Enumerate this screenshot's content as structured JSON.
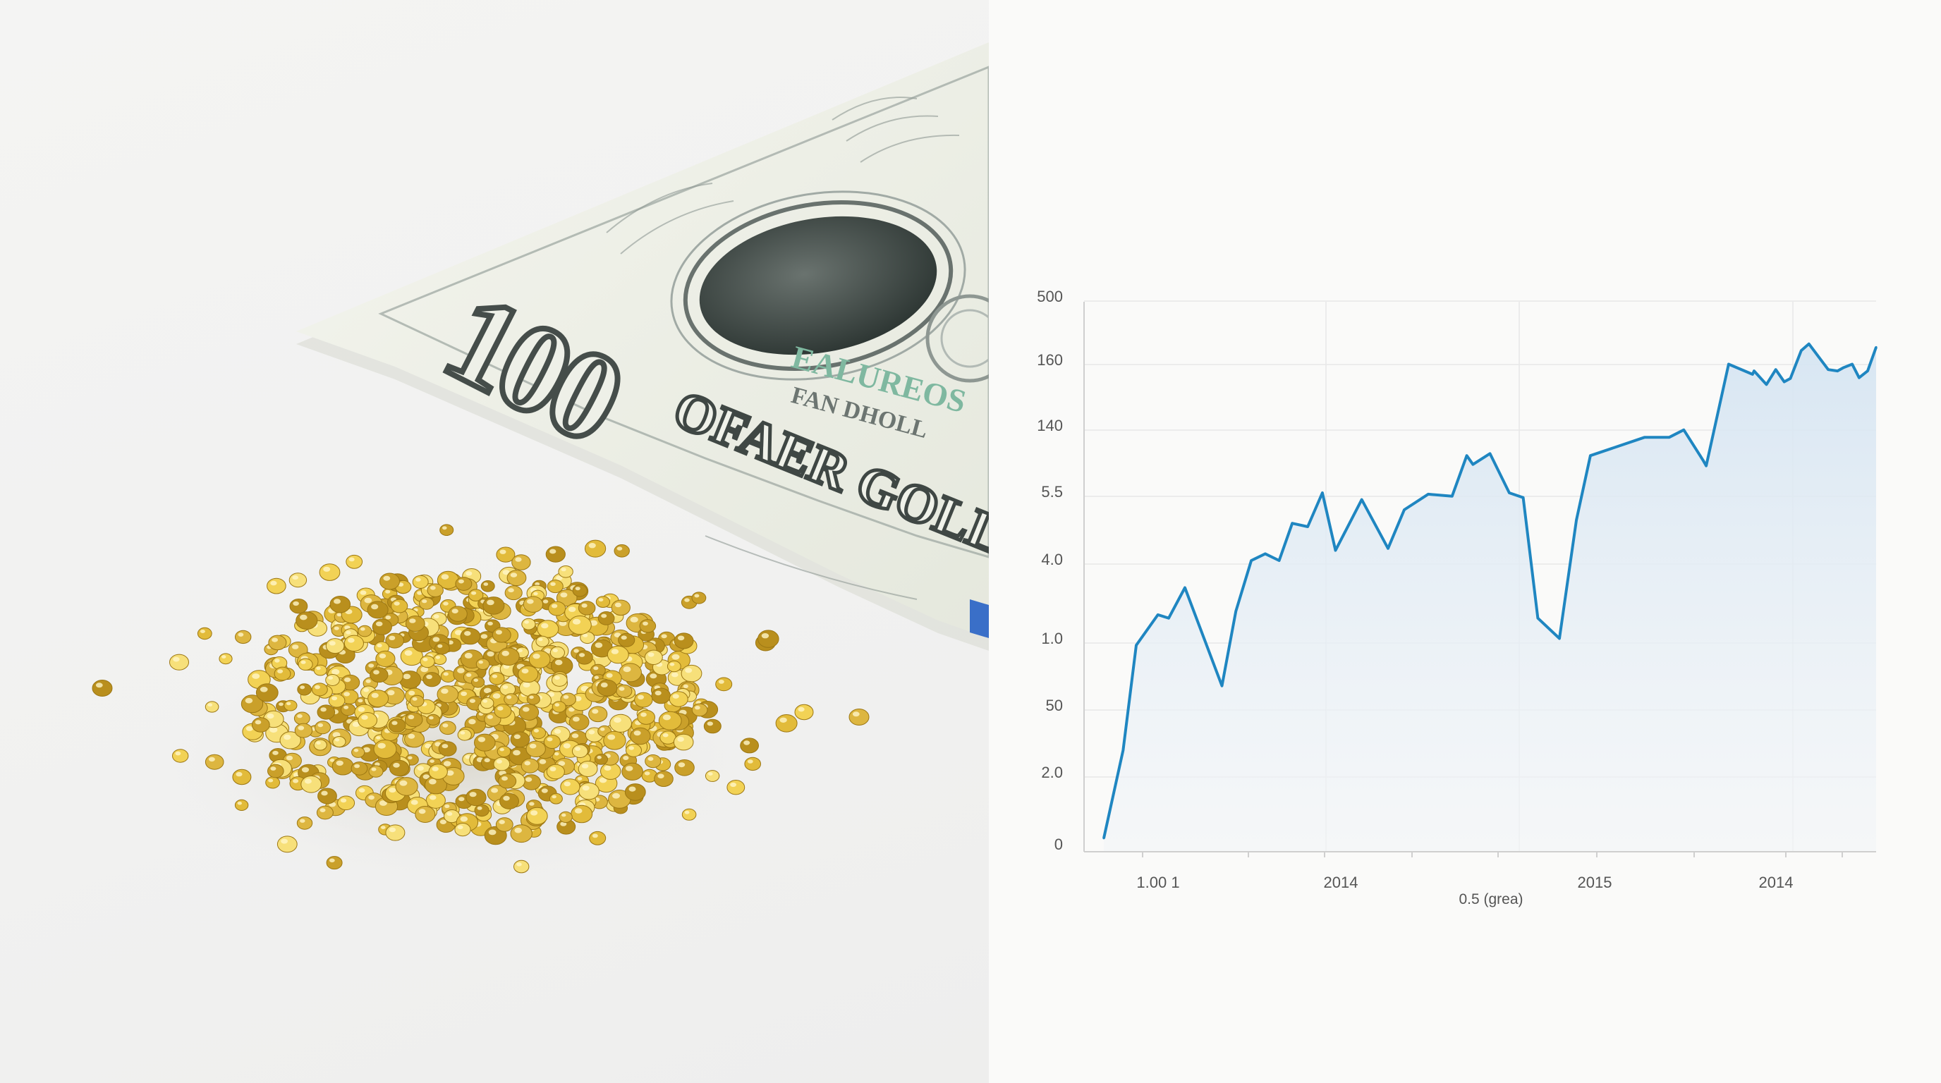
{
  "photo": {
    "banknote": {
      "denomination": "100",
      "lines": [
        "EALUREOS",
        "FAN DHOLL",
        "OFAER GOLL"
      ]
    },
    "colors": {
      "gold": "#e2bb3a",
      "banknote_paper": "#eef0e6",
      "banknote_ink": "#4a5450",
      "banknote_green": "#7fb8a0",
      "blue_strip": "#3a6fc8"
    }
  },
  "chart_data": {
    "type": "area",
    "title": "",
    "xlabel": "",
    "ylabel": "",
    "note": "0.5 (grea)",
    "y_tick_labels": [
      "500",
      "160",
      "140",
      "5.5",
      "4.0",
      "1.0",
      "50",
      "2.0",
      "0"
    ],
    "x_tick_labels": [
      "1.00 1",
      "2014",
      "2015",
      "2014"
    ],
    "ylim": [
      0,
      8
    ],
    "grid": true,
    "legend": "none",
    "colors": {
      "line": "#1f86c1",
      "fill": "#dbe8f3",
      "grid": "#e8e8e8",
      "axis": "#cfcfcf",
      "text": "#555555"
    },
    "series": [
      {
        "x": [
          0.0,
          0.025,
          0.042,
          0.07,
          0.084,
          0.105,
          0.153,
          0.171,
          0.191,
          0.209,
          0.227,
          0.244,
          0.264,
          0.283,
          0.3,
          0.334,
          0.368,
          0.389,
          0.42,
          0.451,
          0.47,
          0.478,
          0.5,
          0.525,
          0.543,
          0.562,
          0.59,
          0.612,
          0.63,
          0.7,
          0.732,
          0.751,
          0.776,
          0.78,
          0.809,
          0.84,
          0.842,
          0.858,
          0.87,
          0.881,
          0.889,
          0.903,
          0.913,
          0.938,
          0.95,
          0.958,
          0.969,
          0.978,
          0.989,
          1.0
        ],
        "y": [
          0.2,
          1.5,
          3.05,
          3.5,
          3.45,
          3.9,
          2.45,
          3.55,
          4.3,
          4.4,
          4.3,
          4.85,
          4.8,
          5.3,
          4.45,
          5.2,
          4.48,
          5.05,
          5.28,
          5.25,
          5.85,
          5.72,
          5.88,
          5.3,
          5.23,
          3.45,
          3.15,
          4.9,
          5.85,
          6.12,
          6.12,
          6.23,
          5.78,
          5.7,
          7.2,
          7.05,
          7.1,
          6.9,
          7.12,
          6.94,
          6.99,
          7.4,
          7.5,
          7.12,
          7.1,
          7.15,
          7.2,
          7.0,
          7.1,
          7.45
        ]
      }
    ]
  }
}
